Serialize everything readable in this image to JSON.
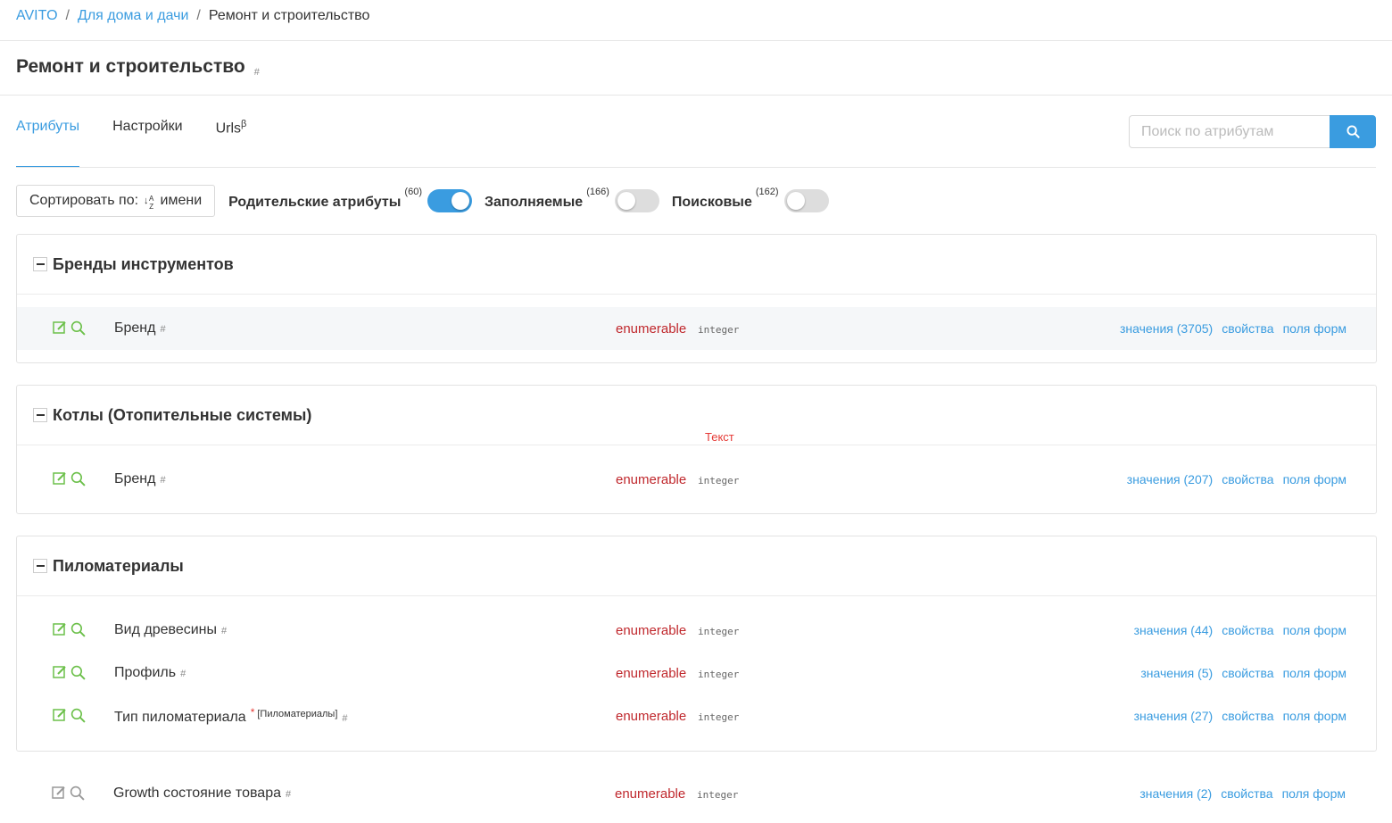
{
  "breadcrumb": {
    "root": "AVITO",
    "parent": "Для дома и дачи",
    "current": "Ремонт и строительство",
    "separator": "/"
  },
  "page": {
    "title": "Ремонт и строительство",
    "hash": "#"
  },
  "tabs": [
    {
      "label": "Атрибуты",
      "sup": ""
    },
    {
      "label": "Настройки",
      "sup": ""
    },
    {
      "label": "Urls",
      "sup": "β"
    }
  ],
  "search": {
    "placeholder": "Поиск по атрибутам",
    "value": ""
  },
  "filters": {
    "sort_label": "Сортировать по:",
    "sort_icon": "sort-alpha-icon",
    "sort_value": "имени",
    "parent": {
      "label": "Родительские атрибуты",
      "count": "(60)",
      "on": true
    },
    "filled": {
      "label": "Заполняемые",
      "count": "(166)",
      "on": false
    },
    "search": {
      "label": "Поисковые",
      "count": "(162)",
      "on": false
    }
  },
  "hint": "Текст",
  "groups": [
    {
      "title": "Бренды инструментов",
      "rows": [
        {
          "name": "Бренд",
          "hash": "#",
          "type": "enumerable",
          "subtype": "integer",
          "values": "значения (3705)",
          "props": "свойства",
          "forms": "поля форм"
        }
      ]
    },
    {
      "title": "Котлы (Отопительные системы)",
      "rows": [
        {
          "name": "Бренд",
          "hash": "#",
          "type": "enumerable",
          "subtype": "integer",
          "values": "значения (207)",
          "props": "свойства",
          "forms": "поля форм"
        }
      ]
    },
    {
      "title": "Пиломатериалы",
      "rows": [
        {
          "name": "Вид древесины",
          "hash": "#",
          "type": "enumerable",
          "subtype": "integer",
          "values": "значения (44)",
          "props": "свойства",
          "forms": "поля форм"
        },
        {
          "name": "Профиль",
          "hash": "#",
          "type": "enumerable",
          "subtype": "integer",
          "values": "значения (5)",
          "props": "свойства",
          "forms": "поля форм"
        },
        {
          "name": "Тип пиломатериала",
          "req": "*",
          "tag": "[Пиломатериалы]",
          "hash": "#",
          "type": "enumerable",
          "subtype": "integer",
          "values": "значения (27)",
          "props": "свойства",
          "forms": "поля форм"
        }
      ]
    }
  ],
  "loose_row": {
    "name": "Growth состояние товара",
    "hash": "#",
    "type": "enumerable",
    "subtype": "integer",
    "values": "значения (2)",
    "props": "свойства",
    "forms": "поля форм"
  },
  "colors": {
    "accent": "#3a9ce0",
    "type": "#c0282d",
    "icon_green": "#6cc04a",
    "required": "#e53935"
  }
}
